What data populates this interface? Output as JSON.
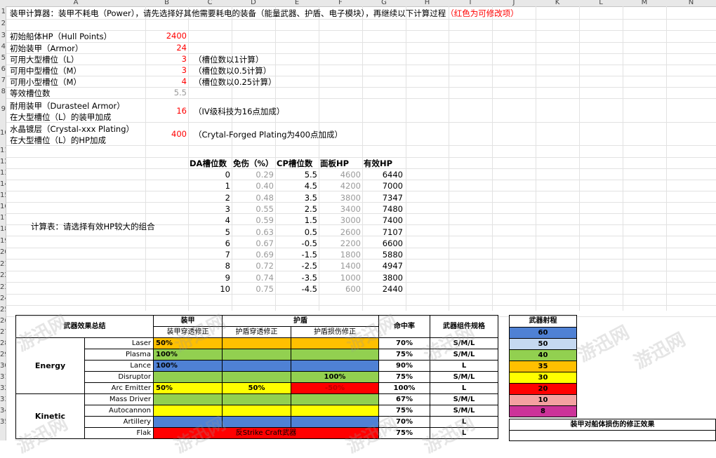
{
  "col_headers": [
    "A",
    "B",
    "C",
    "D",
    "E",
    "F",
    "G",
    "H",
    "I",
    "J",
    "K",
    "L",
    "M",
    "N"
  ],
  "row_headers": [
    "1",
    "2",
    "3",
    "4",
    "5",
    "6",
    "7",
    "8",
    "9",
    "10",
    "11",
    "12",
    "13",
    "14",
    "15",
    "16",
    "17",
    "18",
    "19",
    "20",
    "21",
    "22",
    "23",
    "24",
    "25",
    "26",
    "27",
    "28",
    "29",
    "30",
    "31",
    "32",
    "33",
    "34",
    "35"
  ],
  "intro": {
    "text": "装甲计算器：装甲不耗电（Power），请先选择好其他需要耗电的装备（能量武器、护盾、电子模块），再继续以下计算过程",
    "red_note": "（红色为可修改项）"
  },
  "params": [
    {
      "label": "初始船体HP（Hull Points）",
      "value": "2400",
      "color": "red",
      "note": ""
    },
    {
      "label": "初始装甲（Armor）",
      "value": "24",
      "color": "red",
      "note": ""
    },
    {
      "label": "可用大型槽位（L）",
      "value": "3",
      "color": "red",
      "note": "（槽位数以1计算）"
    },
    {
      "label": "可用中型槽位（M）",
      "value": "3",
      "color": "red",
      "note": "（槽位数以0.5计算）"
    },
    {
      "label": "可用小型槽位（M）",
      "value": "4",
      "color": "red",
      "note": "（槽位数以0.25计算）"
    },
    {
      "label": "等效槽位数",
      "value": "5.5",
      "color": "gray",
      "note": ""
    }
  ],
  "durasteel": {
    "label1": "耐用装甲（Durasteel Armor）",
    "label2": "在大型槽位（L）的装甲加成",
    "value": "16",
    "note": "（IV级科技为16点加成）"
  },
  "crystal": {
    "label1": "水晶镀层（Crystal-xxx Plating）",
    "label2": "在大型槽位（L）的HP加成",
    "value": "400",
    "note": "（Crytal-Forged Plating为400点加成）"
  },
  "calc": {
    "side_label": "计算表：请选择有效HP较大的组合",
    "headers": [
      "DA槽位数",
      "免伤（%）",
      "CP槽位数",
      "面板HP",
      "有效HP"
    ],
    "rows": [
      [
        "0",
        "0.29",
        "5.5",
        "4600",
        "6440"
      ],
      [
        "1",
        "0.40",
        "4.5",
        "4200",
        "7000"
      ],
      [
        "2",
        "0.48",
        "3.5",
        "3800",
        "7347"
      ],
      [
        "3",
        "0.55",
        "2.5",
        "3400",
        "7480"
      ],
      [
        "4",
        "0.59",
        "1.5",
        "3000",
        "7400"
      ],
      [
        "5",
        "0.63",
        "0.5",
        "2600",
        "7107"
      ],
      [
        "6",
        "0.67",
        "-0.5",
        "2200",
        "6600"
      ],
      [
        "7",
        "0.69",
        "-1.5",
        "1800",
        "5880"
      ],
      [
        "8",
        "0.72",
        "-2.5",
        "1400",
        "4947"
      ],
      [
        "9",
        "0.74",
        "-3.5",
        "1000",
        "3800"
      ],
      [
        "10",
        "0.75",
        "-4.5",
        "600",
        "2440"
      ]
    ]
  },
  "weapons": {
    "title": "武器效果总结",
    "armor_header": "装甲",
    "shield_header": "护盾",
    "sub_armor_pen": "装甲穿透修正",
    "sub_shield_pen": "护盾穿透修正",
    "sub_shield_dmg": "护盾损伤修正",
    "hit_header": "命中率",
    "spec_header": "武器组件规格",
    "groups": [
      {
        "name": "Energy",
        "rows": [
          {
            "name": "Laser",
            "armor_pen": "50%",
            "shield_pen": "",
            "shield_dmg": "",
            "hit": "70%",
            "spec": "S/M/L",
            "colors": [
              "#ffc000",
              "#ffc000",
              "#ffc000"
            ]
          },
          {
            "name": "Plasma",
            "armor_pen": "100%",
            "shield_pen": "",
            "shield_dmg": "",
            "hit": "75%",
            "spec": "S/M/L",
            "colors": [
              "#92d050",
              "#92d050",
              "#92d050"
            ]
          },
          {
            "name": "Lance",
            "armor_pen": "100%",
            "shield_pen": "",
            "shield_dmg": "",
            "hit": "90%",
            "spec": "L",
            "colors": [
              "#4f81d4",
              "#4f81d4",
              "#4f81d4"
            ]
          },
          {
            "name": "Disruptor",
            "armor_pen": "",
            "shield_pen": "",
            "shield_dmg": "100%",
            "hit": "75%",
            "spec": "S/M/L",
            "colors": [
              "#92d050",
              "#92d050",
              "#92d050"
            ]
          },
          {
            "name": "Arc Emitter",
            "armor_pen": "50%",
            "shield_pen": "50%",
            "shield_dmg": "-50%",
            "hit": "100%",
            "spec": "L",
            "colors": [
              "#ffff00",
              "#ffff00",
              "#ff0000"
            ]
          }
        ]
      },
      {
        "name": "Kinetic",
        "rows": [
          {
            "name": "Mass Driver",
            "armor_pen": "",
            "shield_pen": "",
            "shield_dmg": "",
            "hit": "67%",
            "spec": "S/M/L",
            "colors": [
              "#92d050",
              "#92d050",
              "#92d050"
            ]
          },
          {
            "name": "Autocannon",
            "armor_pen": "",
            "shield_pen": "",
            "shield_dmg": "",
            "hit": "75%",
            "spec": "S/M/L",
            "colors": [
              "#ffff00",
              "#ffff00",
              "#ffff00"
            ]
          },
          {
            "name": "Artillery",
            "armor_pen": "",
            "shield_pen": "",
            "shield_dmg": "",
            "hit": "70%",
            "spec": "L",
            "colors": [
              "#4f81d4",
              "#4f81d4",
              "#4f81d4"
            ]
          },
          {
            "name": "Flak",
            "armor_pen": "",
            "shield_pen": "",
            "shield_dmg": "",
            "hit": "75%",
            "spec": "L",
            "colors": [
              "#ff0000",
              "#ff0000",
              "#ff0000"
            ],
            "merged_text": "反Strike Craft武器"
          }
        ]
      }
    ]
  },
  "range": {
    "title": "武器射程",
    "values": [
      {
        "v": "60",
        "color": "#4f81d4"
      },
      {
        "v": "50",
        "color": "#c5d9f1"
      },
      {
        "v": "40",
        "color": "#92d050"
      },
      {
        "v": "35",
        "color": "#ffc000"
      },
      {
        "v": "30",
        "color": "#ffff00"
      },
      {
        "v": "20",
        "color": "#ff0000"
      },
      {
        "v": "10",
        "color": "#f4a0a0"
      },
      {
        "v": "8",
        "color": "#cc3399"
      }
    ]
  },
  "modifier_title": "装甲对船体损伤的修正效果",
  "watermark": "游迅网"
}
